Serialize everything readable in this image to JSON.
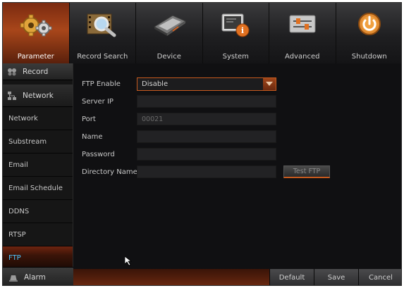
{
  "toolbar": {
    "tabs": [
      {
        "label": "Parameter",
        "icon": "gears-icon"
      },
      {
        "label": "Record Search",
        "icon": "film-search-icon"
      },
      {
        "label": "Device",
        "icon": "hard-drive-icon"
      },
      {
        "label": "System",
        "icon": "monitor-info-icon"
      },
      {
        "label": "Advanced",
        "icon": "sliders-icon"
      },
      {
        "label": "Shutdown",
        "icon": "power-icon"
      }
    ],
    "active_tab": "Parameter"
  },
  "sidebar": {
    "record_label": "Record",
    "network_label": "Network",
    "items": [
      {
        "label": "Network"
      },
      {
        "label": "Substream"
      },
      {
        "label": "Email"
      },
      {
        "label": "Email Schedule"
      },
      {
        "label": "DDNS"
      },
      {
        "label": "RTSP"
      },
      {
        "label": "FTP"
      }
    ],
    "active_item": "FTP",
    "alarm_label": "Alarm"
  },
  "form": {
    "ftp_enable_label": "FTP Enable",
    "ftp_enable_value": "Disable",
    "server_ip_label": "Server IP",
    "server_ip_value": "",
    "port_label": "Port",
    "port_value": "00021",
    "name_label": "Name",
    "name_value": "",
    "password_label": "Password",
    "password_value": "",
    "directory_label": "Directory Name",
    "directory_value": "",
    "test_button": "Test FTP"
  },
  "footer": {
    "default_label": "Default",
    "save_label": "Save",
    "cancel_label": "Cancel"
  },
  "colors": {
    "accent": "#c65a1e",
    "active_text": "#4fc6ff",
    "background": "#101012"
  }
}
